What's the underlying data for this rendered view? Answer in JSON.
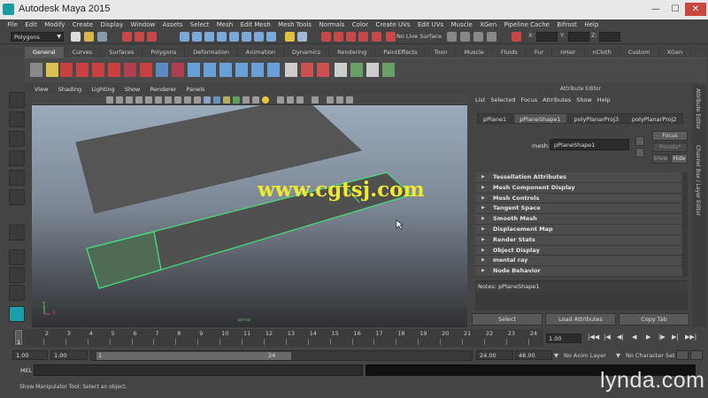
{
  "window": {
    "title": "Autodesk Maya 2015",
    "min": "—",
    "max": "☐",
    "close": "✕"
  },
  "menus": [
    "File",
    "Edit",
    "Modify",
    "Create",
    "Display",
    "Window",
    "Assets",
    "Select",
    "Mesh",
    "Edit Mesh",
    "Mesh Tools",
    "Normals",
    "Color",
    "Create UVs",
    "Edit UVs",
    "Muscle",
    "XGen",
    "Pipeline Cache",
    "Bifrost",
    "Help"
  ],
  "status_line": {
    "mode": "Polygons",
    "live_surface": "No Live Surface",
    "x_label": "X:",
    "y_label": "Y:",
    "z_label": "Z:"
  },
  "shelf": {
    "tabs": [
      "General",
      "Curves",
      "Surfaces",
      "Polygons",
      "Deformation",
      "Animation",
      "Dynamics",
      "Rendering",
      "PaintEffects",
      "Toon",
      "Muscle",
      "Fluids",
      "Fur",
      "nHair",
      "nCloth",
      "Custom",
      "XGen"
    ],
    "active_tab": "General"
  },
  "viewport": {
    "menus": [
      "View",
      "Shading",
      "Lighting",
      "Show",
      "Renderer",
      "Panels"
    ],
    "camera_label": "persp",
    "axis_y": "Y",
    "axis_x": "X",
    "watermark": "www.cgtsj.com"
  },
  "attribute_editor": {
    "header": "Attribute Editor",
    "menus": [
      "List",
      "Selected",
      "Focus",
      "Attributes",
      "Show",
      "Help"
    ],
    "tabs": [
      "pPlane1",
      "pPlaneShape1",
      "polyPlanarProj3",
      "polyPlanarProj2"
    ],
    "active_tab": "pPlaneShape1",
    "mesh_label": "mesh:",
    "mesh_value": "pPlaneShape1",
    "focus_button": "Focus",
    "presets_button": "Presets*",
    "show_button": "Show",
    "hide_button": "Hide",
    "sections": [
      "Tessellation Attributes",
      "Mesh Component Display",
      "Mesh Controls",
      "Tangent Space",
      "Smooth Mesh",
      "Displacement Map",
      "Render Stats",
      "Object Display",
      "mental ray",
      "Node Behavior"
    ],
    "notes_label": "Notes:  pPlaneShape1",
    "select_button": "Select",
    "load_attributes_button": "Load Attributes",
    "copy_tab_button": "Copy Tab",
    "side_tab_1": "Attribute Editor",
    "side_tab_2": "Channel Box / Layer Editor"
  },
  "timeline": {
    "ticks": [
      "1",
      "2",
      "3",
      "4",
      "5",
      "6",
      "7",
      "8",
      "9",
      "10",
      "11",
      "12",
      "13",
      "14",
      "15",
      "16",
      "17",
      "18",
      "19",
      "20",
      "21",
      "22",
      "23",
      "24"
    ],
    "current_frame": "1",
    "current_time_field": "1.00"
  },
  "range_slider": {
    "start_time": "1.00",
    "playback_start": "1.00",
    "range_start": "1",
    "range_end": "24",
    "playback_end": "24.00",
    "end_time": "48.00",
    "anim_layer": "No Anim Layer",
    "character_set": "No Character Set"
  },
  "command_line": {
    "label": "MEL"
  },
  "help_line": {
    "text": "Show Manipulator Tool: Select an object."
  },
  "branding": {
    "lynda": "lynda.com"
  }
}
